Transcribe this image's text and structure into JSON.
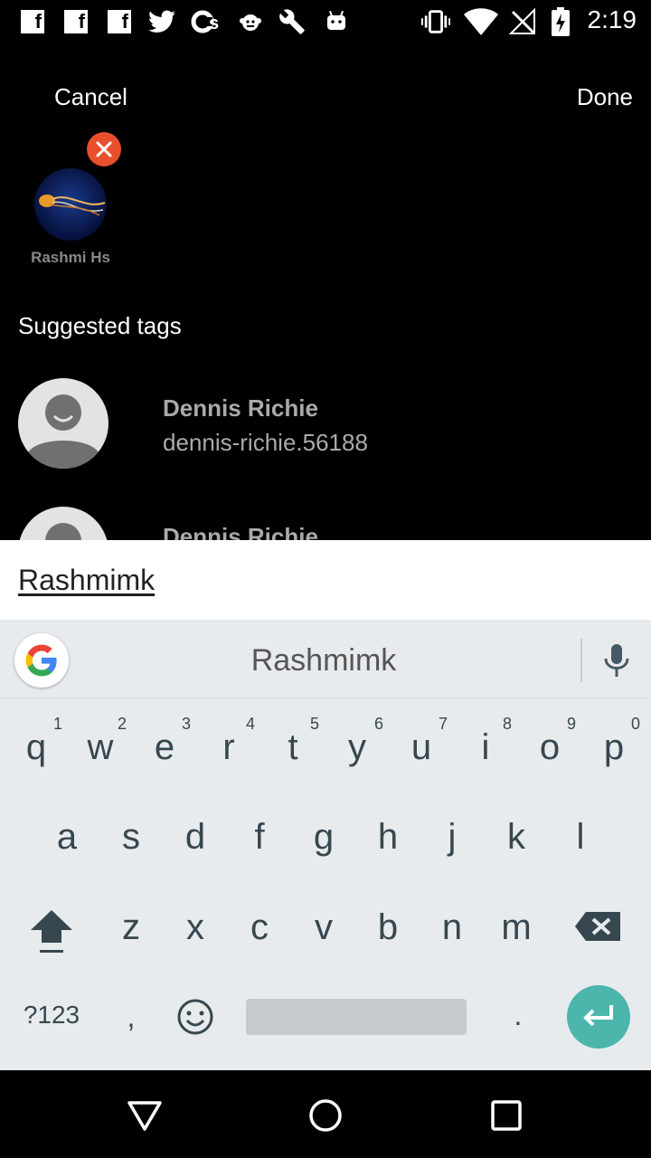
{
  "status_bar": {
    "time": "2:19",
    "left_icons": [
      "facebook-icon",
      "facebook-icon",
      "facebook-icon",
      "twitter-icon",
      "cs-icon",
      "monkey-icon",
      "wrench-icon",
      "android-icon"
    ],
    "right_icons": [
      "vibrate-icon",
      "wifi-icon",
      "no-signal-icon",
      "battery-charging-icon"
    ]
  },
  "header": {
    "cancel_label": "Cancel",
    "done_label": "Done"
  },
  "selected_tags": [
    {
      "name": "Rashmi Hs"
    }
  ],
  "suggested": {
    "heading": "Suggested tags",
    "items": [
      {
        "name": "Dennis Richie",
        "username": "dennis-richie.56188"
      },
      {
        "name": "Dennis Richie"
      }
    ]
  },
  "input": {
    "value": "Rashmimk"
  },
  "keyboard": {
    "suggestion": "Rashmimk",
    "row1": [
      {
        "key": "q",
        "hint": "1"
      },
      {
        "key": "w",
        "hint": "2"
      },
      {
        "key": "e",
        "hint": "3"
      },
      {
        "key": "r",
        "hint": "4"
      },
      {
        "key": "t",
        "hint": "5"
      },
      {
        "key": "y",
        "hint": "6"
      },
      {
        "key": "u",
        "hint": "7"
      },
      {
        "key": "i",
        "hint": "8"
      },
      {
        "key": "o",
        "hint": "9"
      },
      {
        "key": "p",
        "hint": "0"
      }
    ],
    "row2": [
      "a",
      "s",
      "d",
      "f",
      "g",
      "h",
      "j",
      "k",
      "l"
    ],
    "row3": [
      "z",
      "x",
      "c",
      "v",
      "b",
      "n",
      "m"
    ],
    "symbols_label": "?123",
    "comma_label": ",",
    "period_label": "."
  },
  "colors": {
    "remove_badge": "#e8502d",
    "enter_key": "#4db6ac",
    "keyboard_bg": "#e8ebee"
  }
}
